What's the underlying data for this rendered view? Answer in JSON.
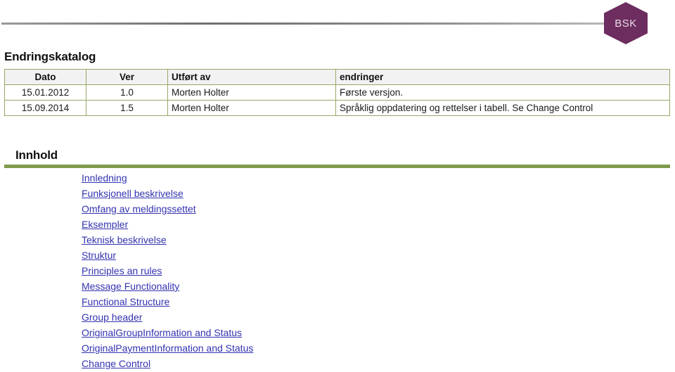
{
  "header": {
    "logo_text": "BSK",
    "logo_color": "#6d2d5f",
    "rule_color": "#7a7a7a"
  },
  "change_catalog": {
    "title": "Endringskatalog",
    "border_color": "#96a766",
    "header_bg": "#f2f2f2",
    "columns": [
      "Dato",
      "Ver",
      "Utført av",
      "endringer"
    ],
    "rows": [
      {
        "dato": "15.01.2012",
        "ver": "1.0",
        "utfort_av": "Morten Holter",
        "endringer": "Første versjon."
      },
      {
        "dato": "15.09.2014",
        "ver": "1.5",
        "utfort_av": "Morten Holter",
        "endringer": "Språklig oppdatering og rettelser i tabell. Se Change Control"
      }
    ]
  },
  "toc": {
    "title": "Innhold",
    "rule_color": "#7f9a4f",
    "link_color": "#3333b0",
    "items": [
      "Innledning",
      "Funksjonell beskrivelse",
      "Omfang av meldingssettet",
      "Eksempler",
      "Teknisk beskrivelse",
      "Struktur",
      "Principles an rules",
      "Message Functionality",
      "Functional Structure",
      "Group header",
      "OriginalGroupInformation and Status",
      "OriginalPaymentInformation and Status",
      "Change Control"
    ]
  }
}
